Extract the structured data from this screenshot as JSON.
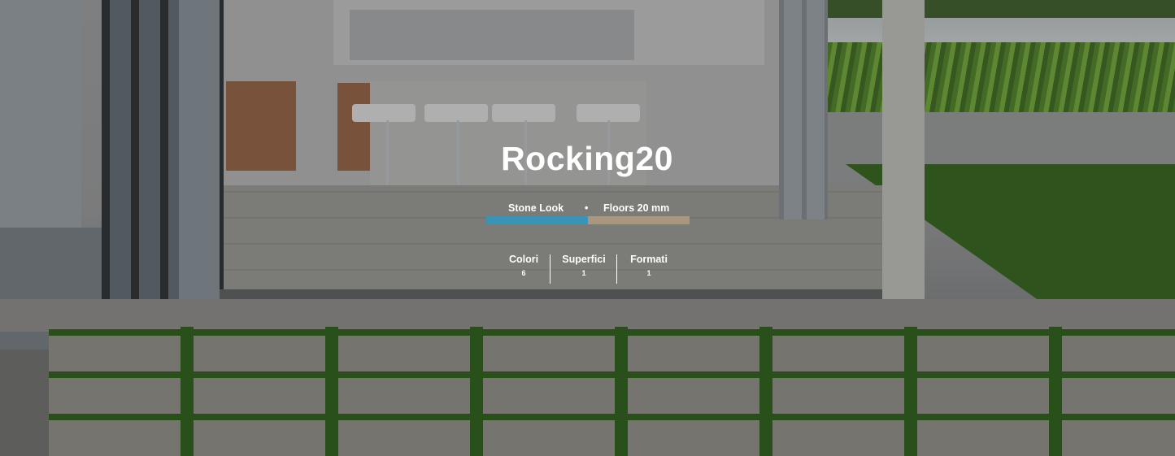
{
  "product": {
    "title": "Rocking20",
    "tags": [
      {
        "label": "Stone Look",
        "color": "#3a94b8"
      },
      {
        "label": "Floors 20 mm",
        "color": "#a9967f"
      }
    ],
    "tag_separator": "•"
  },
  "stats": [
    {
      "label": "Colori",
      "value": "6"
    },
    {
      "label": "Superfici",
      "value": "1"
    },
    {
      "label": "Formati",
      "value": "1"
    }
  ],
  "hero": {
    "image": "outdoor-terrace-kitchen-photo"
  }
}
